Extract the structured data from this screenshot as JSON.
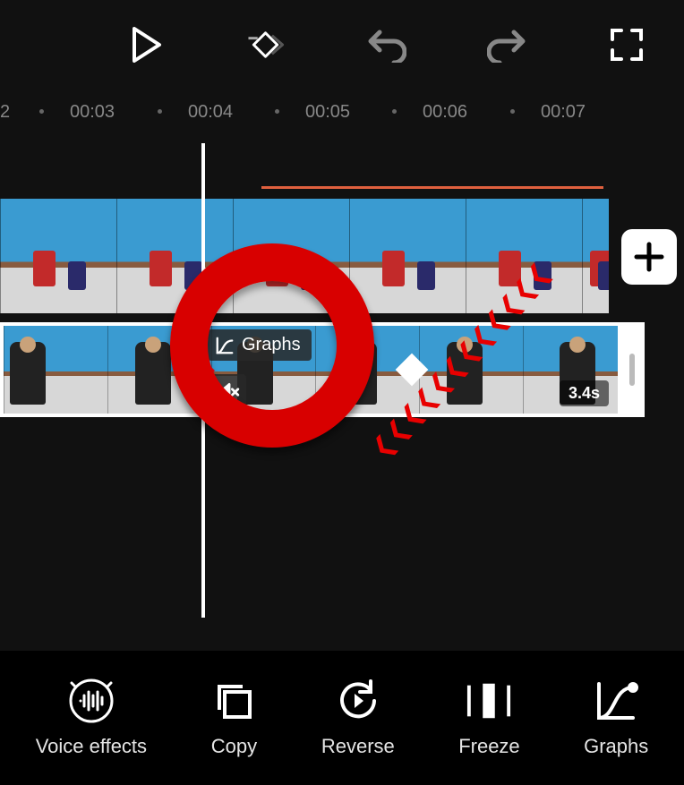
{
  "toolbar": {
    "play": "play",
    "keyframe": "keyframe",
    "undo": "undo",
    "redo": "redo",
    "fullscreen": "fullscreen"
  },
  "ruler": {
    "edge_label": "2",
    "marks": [
      "00:03",
      "00:04",
      "00:05",
      "00:06",
      "00:07"
    ]
  },
  "timeline": {
    "graphs_tooltip": "Graphs",
    "selected_clip_duration": "3.4s"
  },
  "actions": [
    {
      "id": "voice-effects",
      "label": "Voice effects"
    },
    {
      "id": "copy",
      "label": "Copy"
    },
    {
      "id": "reverse",
      "label": "Reverse"
    },
    {
      "id": "freeze",
      "label": "Freeze"
    },
    {
      "id": "graphs",
      "label": "Graphs"
    }
  ]
}
